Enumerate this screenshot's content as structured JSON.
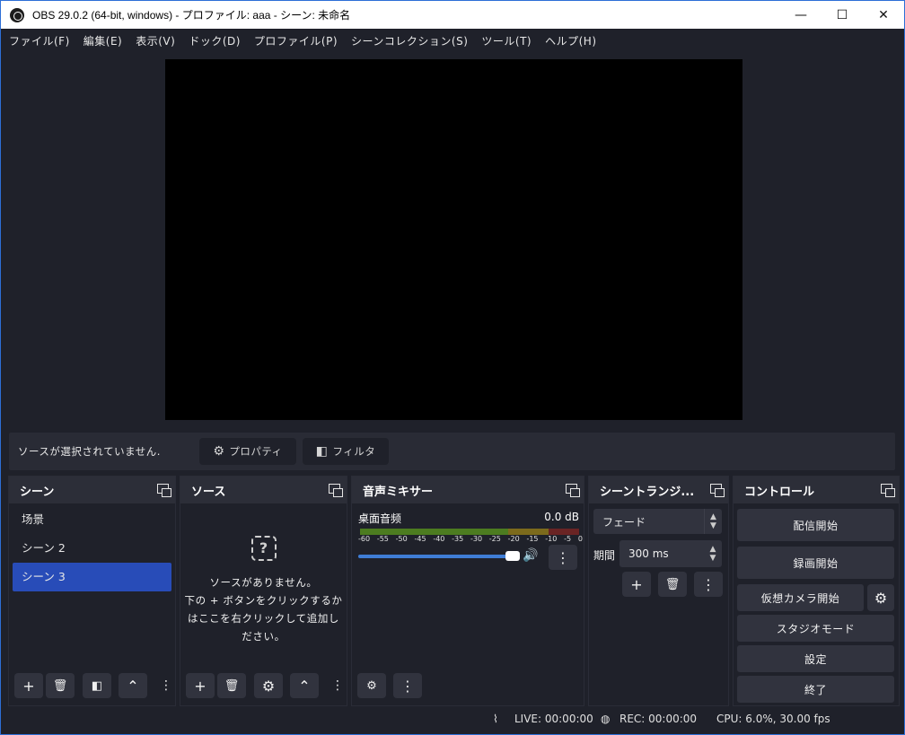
{
  "window": {
    "title": "OBS 29.0.2 (64-bit, windows) - プロファイル: aaa - シーン: 未命名",
    "minimize": "—",
    "maximize": "☐",
    "close": "✕"
  },
  "menu": [
    "ファイル(F)",
    "編集(E)",
    "表示(V)",
    "ドック(D)",
    "プロファイル(P)",
    "シーンコレクション(S)",
    "ツール(T)",
    "ヘルプ(H)"
  ],
  "source_toolbar": {
    "no_source_text": "ソースが選択されていません.",
    "properties_label": "プロパティ",
    "filters_label": "フィルタ"
  },
  "scenes": {
    "title": "シーン",
    "items": [
      {
        "label": "场景",
        "selected": false
      },
      {
        "label": "シーン 2",
        "selected": false
      },
      {
        "label": "シーン 3",
        "selected": true
      }
    ]
  },
  "sources": {
    "title": "ソース",
    "empty_line1": "ソースがありません。",
    "empty_line2": "下の + ボタンをクリックするか",
    "empty_line3": "はここを右クリックして追加し",
    "empty_line4": "ださい。"
  },
  "mixer": {
    "title": "音声ミキサー",
    "channel_name": "桌面音频",
    "channel_db": "0.0 dB",
    "ticks": [
      "-60",
      "-55",
      "-50",
      "-45",
      "-40",
      "-35",
      "-30",
      "-25",
      "-20",
      "-15",
      "-10",
      "-5",
      "0"
    ],
    "volume_fraction": 1.0
  },
  "transitions": {
    "title": "シーントランジ...",
    "selected": "フェード",
    "duration_label": "期間",
    "duration_value": "300 ms"
  },
  "controls": {
    "title": "コントロール",
    "start_streaming": "配信開始",
    "start_recording": "録画開始",
    "virtual_camera": "仮想カメラ開始",
    "studio_mode": "スタジオモード",
    "settings": "設定",
    "exit": "終了"
  },
  "status": {
    "live": "LIVE: 00:00:00",
    "rec": "REC: 00:00:00",
    "cpu": "CPU: 6.0%, 30.00 fps"
  },
  "icons": {
    "plus": "+",
    "trash": "🗑",
    "gear": "⚙",
    "up": "⌃",
    "kebab": "⋮",
    "speaker": "🔊",
    "filter": "◧",
    "question": "?"
  }
}
